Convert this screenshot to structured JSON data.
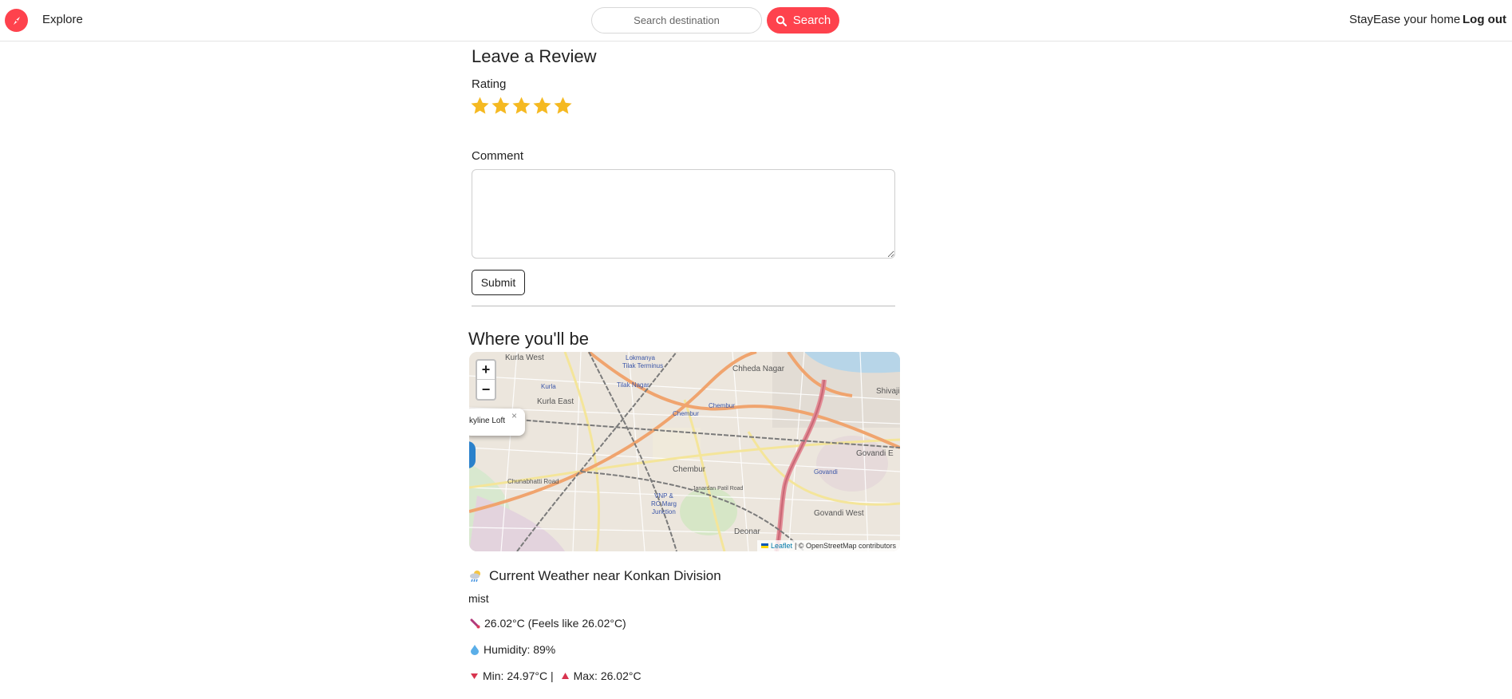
{
  "navbar": {
    "explore_label": "Explore",
    "search_placeholder": "Search destination",
    "search_button_label": "Search",
    "host_label": "StayEase your home",
    "logout_label": "Log out",
    "brand_color": "#fe424d"
  },
  "review": {
    "title": "Leave a Review",
    "rating_label": "Rating",
    "rating_value": 5,
    "rating_max": 5,
    "star_color": "#f5b921",
    "comment_label": "Comment",
    "comment_value": "",
    "submit_label": "Submit"
  },
  "map": {
    "title": "Where you'll be",
    "zoom_in": "+",
    "zoom_out": "−",
    "popup_text": "kyline Loft",
    "popup_close": "×",
    "labels": [
      "Kurla West",
      "Lokmanya",
      "Tilak Terminus",
      "Chheda Nagar",
      "Shivaji",
      "Kurla",
      "Tilak Nagar",
      "Kurla East",
      "Chembur",
      "Chembur",
      "Govandi E",
      "Chunabhatti Road",
      "Chembur",
      "Govandi",
      "Janardan Patil Road",
      "VNP &",
      "RC Marg",
      "Junction",
      "Govandi West",
      "Deonar"
    ],
    "attribution_leaflet": "Leaflet",
    "attribution_osm": "| © OpenStreetMap contributors"
  },
  "weather": {
    "title": "Current Weather near Konkan Division",
    "description": "mist",
    "temperature_line": "26.02°C (Feels like 26.02°C)",
    "humidity_line": "Humidity: 89%",
    "min_line": "Min: 24.97°C |",
    "max_line": "Max: 26.02°C"
  }
}
